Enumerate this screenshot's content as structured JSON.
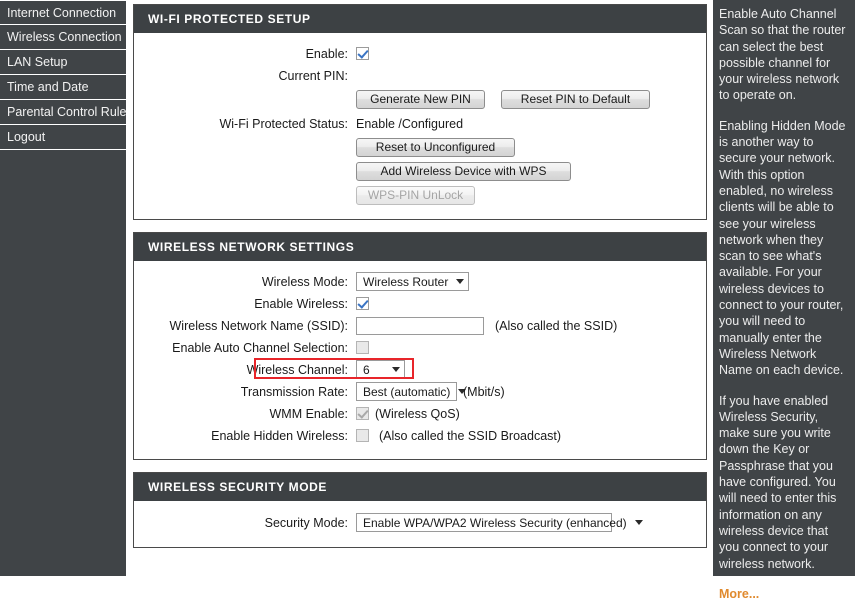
{
  "sidebar": {
    "items": [
      {
        "label": "Internet Connection",
        "name": "internet-connection"
      },
      {
        "label": "Wireless Connection",
        "name": "wireless-connection"
      },
      {
        "label": "LAN Setup",
        "name": "lan-setup"
      },
      {
        "label": "Time and Date",
        "name": "time-and-date"
      },
      {
        "label": "Parental Control Rules",
        "name": "parental-control-rules"
      },
      {
        "label": "Logout",
        "name": "logout"
      }
    ]
  },
  "wps": {
    "title": "WI-FI PROTECTED SETUP",
    "enable_label": "Enable:",
    "enable_checked": true,
    "current_pin_label": "Current PIN:",
    "current_pin_value": "",
    "generate_pin_button": "Generate New PIN",
    "reset_pin_button": "Reset PIN to Default",
    "status_label": "Wi-Fi Protected Status:",
    "status_value": "Enable /Configured",
    "reset_unconfigured_button": "Reset to Unconfigured",
    "add_device_button": "Add Wireless Device with WPS",
    "wps_pin_unlock_button": "WPS-PIN UnLock",
    "wps_pin_unlock_disabled": true
  },
  "network": {
    "title": "WIRELESS NETWORK SETTINGS",
    "wireless_mode_label": "Wireless Mode:",
    "wireless_mode_value": "Wireless Router",
    "enable_wireless_label": "Enable Wireless:",
    "enable_wireless_checked": true,
    "ssid_label": "Wireless Network Name (SSID):",
    "ssid_value": "",
    "ssid_note": "(Also called the SSID)",
    "auto_channel_label": "Enable Auto Channel Selection:",
    "auto_channel_checked": false,
    "channel_label": "Wireless Channel:",
    "channel_value": "6",
    "transmission_rate_label": "Transmission Rate:",
    "transmission_rate_value": "Best (automatic)",
    "transmission_rate_note": "(Mbit/s)",
    "wmm_label": "WMM Enable:",
    "wmm_checked": true,
    "wmm_note": "(Wireless QoS)",
    "hidden_wireless_label": "Enable Hidden Wireless:",
    "hidden_wireless_checked": false,
    "hidden_wireless_note": "(Also called the SSID Broadcast)",
    "highlight_color": "#e8252a"
  },
  "security": {
    "title": "WIRELESS SECURITY MODE",
    "security_mode_label": "Security Mode:",
    "security_mode_value": "Enable WPA/WPA2 Wireless Security (enhanced)"
  },
  "help": {
    "paragraph_1": "Enable Auto Channel Scan so that the router can select the best possible channel for your wireless network to operate on.",
    "paragraph_2": "Enabling Hidden Mode is another way to secure your network. With this option enabled, no wireless clients will be able to see your wireless network when they scan to see what's available. For your wireless devices to connect to your router, you will need to manually enter the Wireless Network Name on each device.",
    "paragraph_3": "If you have enabled Wireless Security, make sure you write down the Key or Passphrase that you have configured. You will need to enter this information on any wireless device that you connect to your wireless network.",
    "more_link": "More..."
  }
}
